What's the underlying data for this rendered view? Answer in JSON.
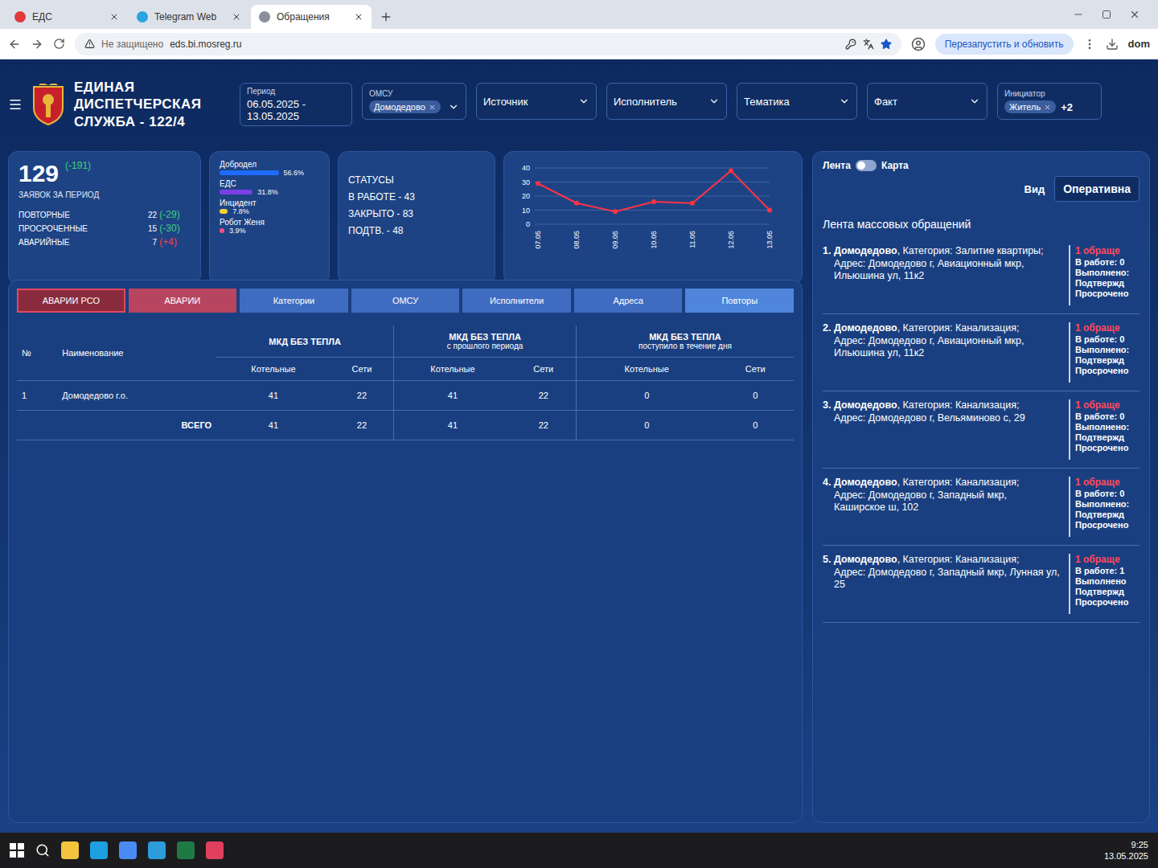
{
  "browser": {
    "tabs": [
      {
        "label": "ЕДС",
        "selected": false
      },
      {
        "label": "Telegram Web",
        "selected": false
      },
      {
        "label": "Обращения",
        "selected": true
      }
    ],
    "security": "Не защищено",
    "url": "eds.bi.mosreg.ru",
    "update_button": "Перезапустить и обновить",
    "profile_text": "dom"
  },
  "header": {
    "title_lines": [
      "ЕДИНАЯ",
      "ДИСПЕТЧЕРСКАЯ",
      "СЛУЖБА - 122/4"
    ]
  },
  "filters": [
    {
      "kind": "date",
      "label": "Период",
      "value": "06.05.2025 - 13.05.2025"
    },
    {
      "kind": "chips",
      "label": "ОМСУ",
      "chips": [
        "Домодедово"
      ],
      "more": ""
    },
    {
      "kind": "select",
      "label": "Источник"
    },
    {
      "kind": "select",
      "label": "Исполнитель"
    },
    {
      "kind": "select",
      "label": "Тематика"
    },
    {
      "kind": "select",
      "label": "Факт"
    },
    {
      "kind": "chips",
      "label": "Инициатор",
      "chips": [
        "Житель"
      ],
      "more": "+2"
    }
  ],
  "summary": {
    "total": "129",
    "delta": "(-191)",
    "caption": "ЗАЯВОК ЗА ПЕРИОД",
    "rows": [
      {
        "label": "ПОВТОРНЫЕ",
        "value": "22",
        "delta": "(-29)",
        "color": "#3fd27a"
      },
      {
        "label": "ПРОСРОЧЕННЫЕ",
        "value": "15",
        "delta": "(-30)",
        "color": "#3fd27a"
      },
      {
        "label": "АВАРИЙНЫЕ",
        "value": "7",
        "delta": "(+4)",
        "color": "#ff3b4a"
      }
    ]
  },
  "sources": [
    {
      "label": "Добродел",
      "share": "56.6%",
      "level": 0.566,
      "color": "#1e6cff"
    },
    {
      "label": "ЕДС",
      "share": "31.8%",
      "level": 0.318,
      "color": "#7b3fe4"
    },
    {
      "label": "Инцидент",
      "share": "7.8%",
      "level": 0.078,
      "color": "#f2d230"
    },
    {
      "label": "Робот Женя",
      "share": "3.9%",
      "level": 0.039,
      "color": "#ff4f8a"
    }
  ],
  "statuses": {
    "title": "СТАТУСЫ",
    "items": [
      "В РАБОТЕ - 43",
      "ЗАКРЫТО - 83",
      "ПОДТВ. - 48"
    ]
  },
  "chart": {
    "y_ticks": [
      "40",
      "30",
      "20",
      "10",
      "0"
    ],
    "x_labels": [
      "07.05",
      "08.05",
      "09.05",
      "10.05",
      "11.05",
      "12.05",
      "13.05"
    ],
    "series": [
      {
        "values": [
          29,
          15,
          9,
          16,
          15,
          38,
          10
        ],
        "color": "#ff3344"
      }
    ]
  },
  "nav_tabs": [
    {
      "label": "АВАРИИ РСО",
      "selected": true,
      "color": "#8a2b3d"
    },
    {
      "label": "АВАРИИ",
      "selected": false,
      "color": "#b8455f"
    },
    {
      "label": "Категории",
      "selected": false,
      "color": "#3f6cc0"
    },
    {
      "label": "ОМСУ",
      "selected": false,
      "color": "#3f6cc0"
    },
    {
      "label": "Исполнители",
      "selected": false,
      "color": "#3f6cc0"
    },
    {
      "label": "Адреса",
      "selected": false,
      "color": "#3f6cc0"
    },
    {
      "label": "Повторы",
      "selected": false,
      "color": "#4f86dc"
    }
  ],
  "table": {
    "index_label": "№",
    "name_label": "Наименование",
    "groups": [
      {
        "title": "МКД БЕЗ ТЕПЛА",
        "subtitle": "",
        "columns": [
          "Котельные",
          "Сети"
        ]
      },
      {
        "title": "МКД БЕЗ ТЕПЛА",
        "subtitle": "с прошлого периода",
        "columns": [
          "Котельные",
          "Сети"
        ]
      },
      {
        "title": "МКД БЕЗ ТЕПЛА",
        "subtitle": "поступило в течение дня",
        "columns": [
          "Котельные",
          "Сети"
        ]
      }
    ],
    "rows": [
      {
        "cells": [
          "1",
          "Домодедово г.о.",
          "41",
          "22",
          "41",
          "22",
          "0",
          "0"
        ]
      }
    ],
    "total": {
      "label": "ВСЕГО",
      "cells": [
        "41",
        "22",
        "41",
        "22",
        "0",
        "0"
      ]
    }
  },
  "feed": {
    "switch": {
      "left": "Лента",
      "right": "Карта",
      "on": false
    },
    "view": {
      "label": "Вид",
      "value": "Оперативна"
    },
    "title": "Лента массовых обращений",
    "items": [
      {
        "number": "1.",
        "city": "Домодедово",
        "category": ", Категория: Залитие квартиры;",
        "address": "Адрес: Домодедово г, Авиационный мкр, Ильюшина ул, 11к2",
        "count": "1 обраще",
        "stats": [
          "В работе: 0",
          "Выполнено:",
          "Подтвержд",
          "Просрочено"
        ]
      },
      {
        "number": "2.",
        "city": "Домодедово",
        "category": ", Категория: Канализация;",
        "address": "Адрес: Домодедово г, Авиационный мкр, Ильюшина ул, 11к2",
        "count": "1 обраще",
        "stats": [
          "В работе: 0",
          "Выполнено:",
          "Подтвержд",
          "Просрочено"
        ]
      },
      {
        "number": "3.",
        "city": "Домодедово",
        "category": ", Категория: Канализация;",
        "address": "Адрес: Домодедово г, Вельяминово с, 29",
        "count": "1 обраще",
        "stats": [
          "В работе: 0",
          "Выполнено:",
          "Подтвержд",
          "Просрочено"
        ]
      },
      {
        "number": "4.",
        "city": "Домодедово",
        "category": ", Категория: Канализация;",
        "address": "Адрес: Домодедово г, Западный мкр, Каширское ш, 102",
        "count": "1 обраще",
        "stats": [
          "В работе: 0",
          "Выполнено:",
          "Подтвержд",
          "Просрочено"
        ]
      },
      {
        "number": "5.",
        "city": "Домодедово",
        "category": ", Категория: Канализация;",
        "address": "Адрес: Домодедово г, Западный мкр, Лунная ул, 25",
        "count": "1 обраще",
        "stats": [
          "В работе: 1",
          "Выполнено",
          "Подтвержд",
          "Просрочено"
        ]
      }
    ]
  },
  "taskbar": {
    "time": "9:25",
    "date": "13.05.2025"
  }
}
